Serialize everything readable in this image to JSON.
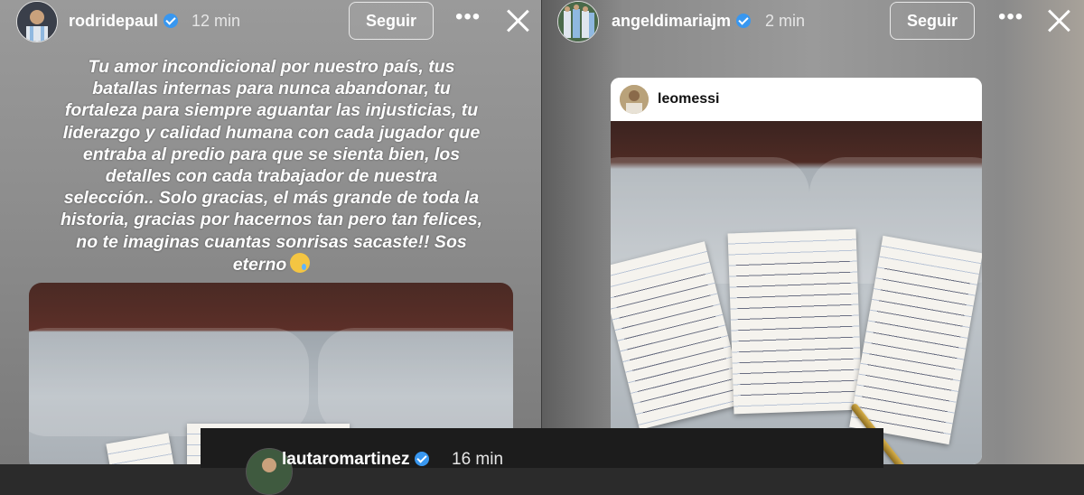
{
  "left_story": {
    "username": "rodridepaul",
    "time": "12 min",
    "follow_label": "Seguir",
    "caption_lines": [
      "Tu amor incondicional por nuestro país, tus",
      "batallas internas para nunca abandonar, tu",
      "fortaleza para siempre aguantar las injusticias, tu",
      "liderazgo y calidad humana con cada jugador que",
      "entraba al predio para que se sienta bien, los",
      "detalles con cada trabajador de nuestra",
      "selección.. Solo gracias, el más grande de toda la",
      "historia, gracias por hacernos tan pero tan felices,",
      "no te imaginas cuantas sonrisas sacaste!! Sos",
      "eterno"
    ],
    "caption_emoji": "crying-face-emoji"
  },
  "right_story": {
    "username": "angeldimariajm",
    "time": "2 min",
    "follow_label": "Seguir",
    "shared_post_username": "leomessi"
  },
  "bottom_story": {
    "username": "lautaromartinez",
    "time": "16 min"
  },
  "colors": {
    "verified": "#3897f0",
    "text": "#ffffff"
  },
  "icons": [
    "more-icon",
    "close-icon",
    "verified-badge-icon"
  ]
}
